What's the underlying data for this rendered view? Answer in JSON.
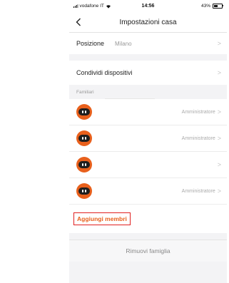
{
  "status_bar": {
    "carrier": "vodafone IT",
    "time": "14:56",
    "battery": "43%"
  },
  "header": {
    "title": "Impostazioni casa",
    "back_icon": "chevron-left-icon"
  },
  "location": {
    "label": "Posizione",
    "value": "Milano"
  },
  "share": {
    "label": "Condividi dispositivi"
  },
  "members_section": {
    "title": "Familiari"
  },
  "members": [
    {
      "role": "Amministratore"
    },
    {
      "role": "Amministratore"
    },
    {
      "role": ""
    },
    {
      "role": "Amministratore"
    }
  ],
  "actions": {
    "add_members": "Aggiungi membri",
    "remove_family": "Rimuovi famiglia"
  },
  "colors": {
    "accent": "#e8601c",
    "highlight_box": "#e02020"
  }
}
